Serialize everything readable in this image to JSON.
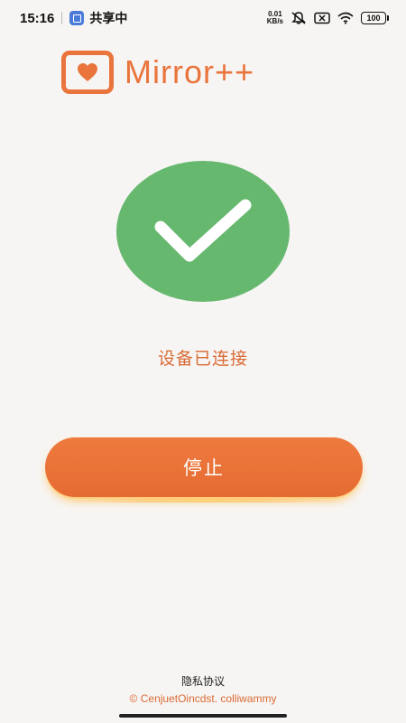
{
  "status_bar": {
    "time": "15:16",
    "share_label": "共享中",
    "net_speed_value": "0.01",
    "net_speed_unit": "KB/s",
    "battery": "100",
    "icons": [
      "share-screen-icon",
      "mute-icon",
      "sim-off-icon",
      "wifi-icon",
      "battery-icon"
    ]
  },
  "brand": {
    "name": "Mirror++",
    "logo_icon": "heart-logo-icon",
    "accent_color": "#e9743c"
  },
  "status": {
    "icon": "check-icon",
    "circle_color": "#66b86f",
    "text": "设备已连接"
  },
  "actions": {
    "stop_label": "停止"
  },
  "footer": {
    "privacy_label": "隐私协议",
    "copyright": "© CenjuetOincdst. colliwammy"
  }
}
